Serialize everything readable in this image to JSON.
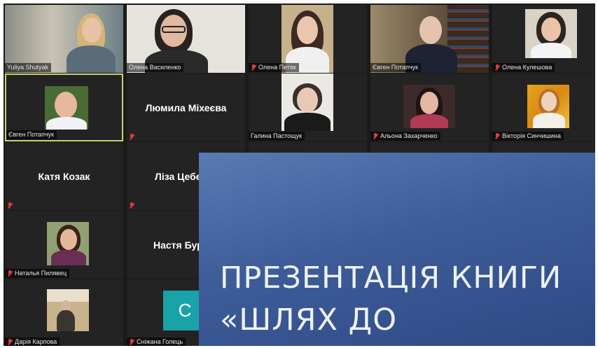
{
  "participants": [
    {
      "name": "Yuliya Shutyak",
      "muted": false
    },
    {
      "name": "Олена Василенко",
      "muted": false
    },
    {
      "name": "Олена Петяк",
      "muted": true
    },
    {
      "name": "Євген Потапчук",
      "muted": false
    },
    {
      "name": "Олена Кулешова",
      "muted": true
    },
    {
      "name": "Євген Потапчук",
      "muted": false,
      "active": true
    },
    {
      "name": "Люмила Міхеєва",
      "muted": true
    },
    {
      "name": "Галина Пастощук",
      "muted": false
    },
    {
      "name": "Альона Захарченко",
      "muted": true
    },
    {
      "name": "Вікторія Синчишина",
      "muted": true
    },
    {
      "name": "Катя Козак",
      "muted": true
    },
    {
      "name": "Ліза Цебе",
      "muted": true
    },
    {
      "name": "Наталья Пилявец",
      "muted": true
    },
    {
      "name": "Настя Бур",
      "muted": false
    },
    {
      "name": "Дарія Карпова",
      "muted": true
    },
    {
      "name": "Сніжана Голець",
      "muted": true
    },
    {
      "avatar_letter": "С"
    }
  ],
  "slide": {
    "line1": "ПРЕЗЕНТАЦІЯ КНИГИ",
    "line2": "«ШЛЯХ ДО"
  },
  "colors": {
    "active_border": "#c9d36a",
    "mute_icon": "#e23b3b",
    "avatar_bg": "#19a3a8",
    "slide_bg": "#3e5c98"
  }
}
